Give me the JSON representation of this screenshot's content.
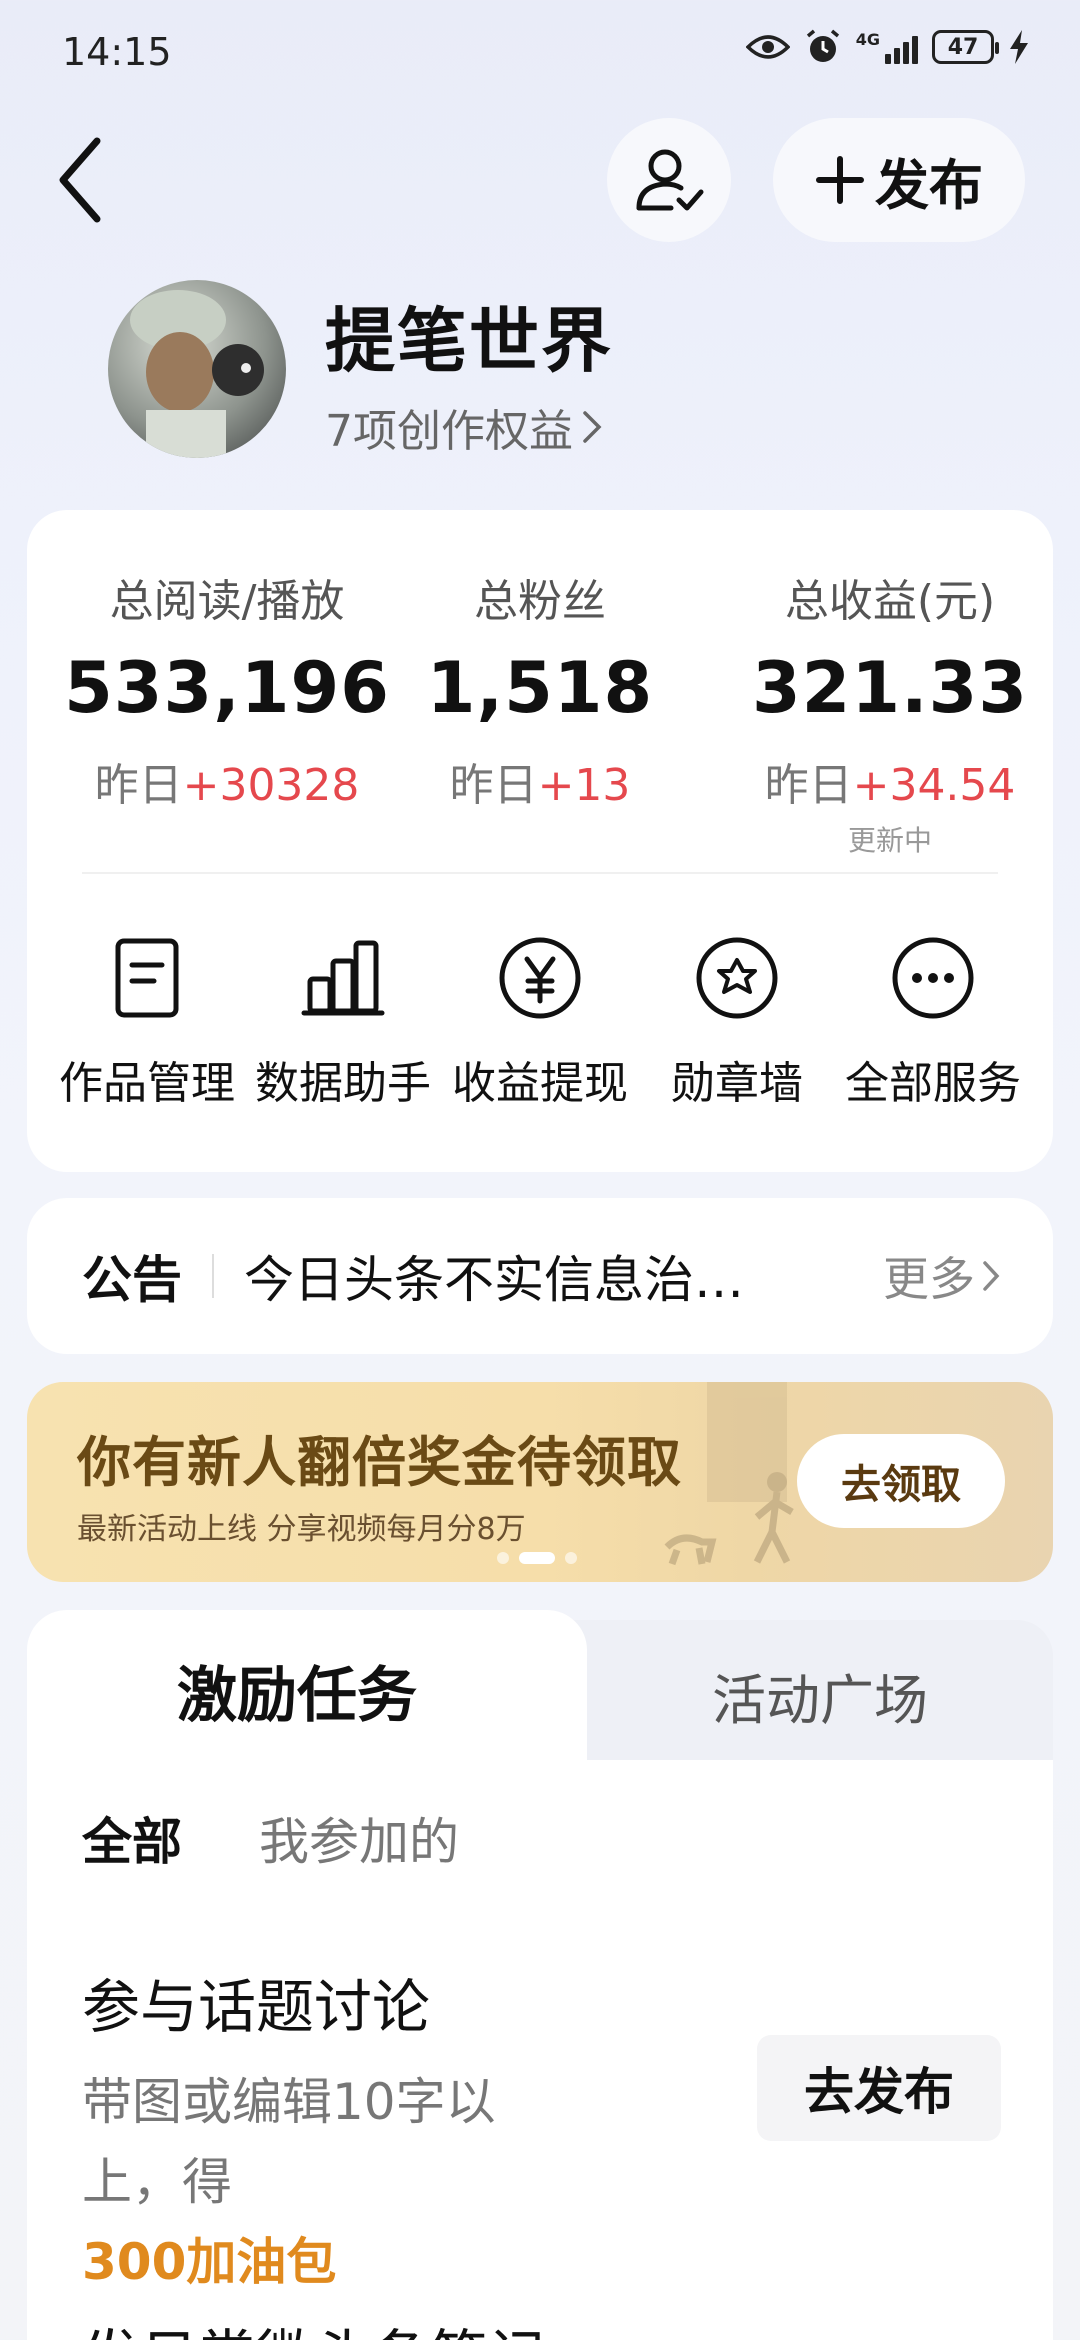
{
  "status_bar": {
    "time": "14:15",
    "network": "4G",
    "battery": "47",
    "icons": [
      "eye-icon",
      "alarm-icon",
      "signal-icon",
      "battery-icon",
      "charging-icon"
    ]
  },
  "nav": {
    "back_icon": "chevron-left-icon",
    "user_icon": "user-check-icon",
    "publish_label": "发布"
  },
  "profile": {
    "name": "提笔世界",
    "benefits": "7项创作权益"
  },
  "stats": {
    "reads": {
      "label": "总阅读/播放",
      "value": "533,196",
      "delta_prefix": "昨日",
      "delta": "+30328"
    },
    "fans": {
      "label": "总粉丝",
      "value": "1,518",
      "delta_prefix": "昨日",
      "delta": "+13"
    },
    "income": {
      "label": "总收益(元)",
      "value": "321.33",
      "delta_prefix": "昨日",
      "delta": "+34.54",
      "note": "更新中"
    }
  },
  "services": [
    {
      "label": "作品管理",
      "icon": "document-icon"
    },
    {
      "label": "数据助手",
      "icon": "bar-chart-icon"
    },
    {
      "label": "收益提现",
      "icon": "yuan-icon"
    },
    {
      "label": "勋章墙",
      "icon": "medal-icon"
    },
    {
      "label": "全部服务",
      "icon": "more-icon"
    }
  ],
  "notice": {
    "title": "公告",
    "text": "今日头条不实信息治…",
    "more": "更多"
  },
  "banner": {
    "title": "你有新人翻倍奖金待领取",
    "subtitle": "最新活动上线 分享视频每月分8万",
    "button": "去领取"
  },
  "tasks": {
    "tab_active": "激励任务",
    "tab_inactive": "活动广场",
    "filter_all": "全部",
    "filter_mine": "我参加的",
    "item": {
      "title": "参与话题讨论",
      "desc": "带图或编辑10字以上，得",
      "reward": "300加油包",
      "button": "去发布"
    },
    "next_item_title": "发日常微头条笔记"
  },
  "colors": {
    "accent_red": "#e5484d",
    "reward_orange": "#e08a1e",
    "banner_gold": "#f6deaa"
  }
}
